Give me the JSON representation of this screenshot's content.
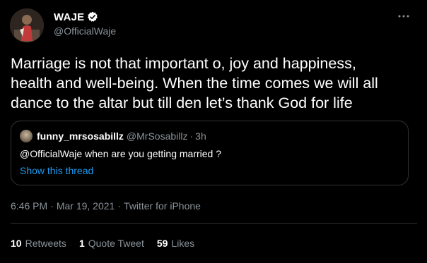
{
  "user": {
    "display_name": "WAJE",
    "handle": "@OfficialWaje",
    "verified_icon": "verified-badge-icon"
  },
  "tweet": {
    "text": "Marriage is not that important o, joy and happiness,\nhealth and well-being. When the time comes we will all\ndance to the altar but till den let’s thank God for life"
  },
  "quote": {
    "name": "funny_mrsosabillz",
    "handle": "@MrSosabillz",
    "dot": "·",
    "time": "3h",
    "text": "@OfficialWaje when are you getting married ?",
    "show_thread": "Show this thread"
  },
  "meta": {
    "time": "6:46 PM",
    "sep1": "·",
    "date": "Mar 19, 2021",
    "sep2": "·",
    "source": "Twitter for iPhone"
  },
  "stats": {
    "retweets": {
      "count": "10",
      "label": "Retweets"
    },
    "quotes": {
      "count": "1",
      "label": "Quote Tweet"
    },
    "likes": {
      "count": "59",
      "label": "Likes"
    }
  },
  "colors": {
    "background": "#000000",
    "text": "#ffffff",
    "secondary": "#8b9399",
    "link": "#1d9bf0",
    "border": "#2f3336"
  }
}
